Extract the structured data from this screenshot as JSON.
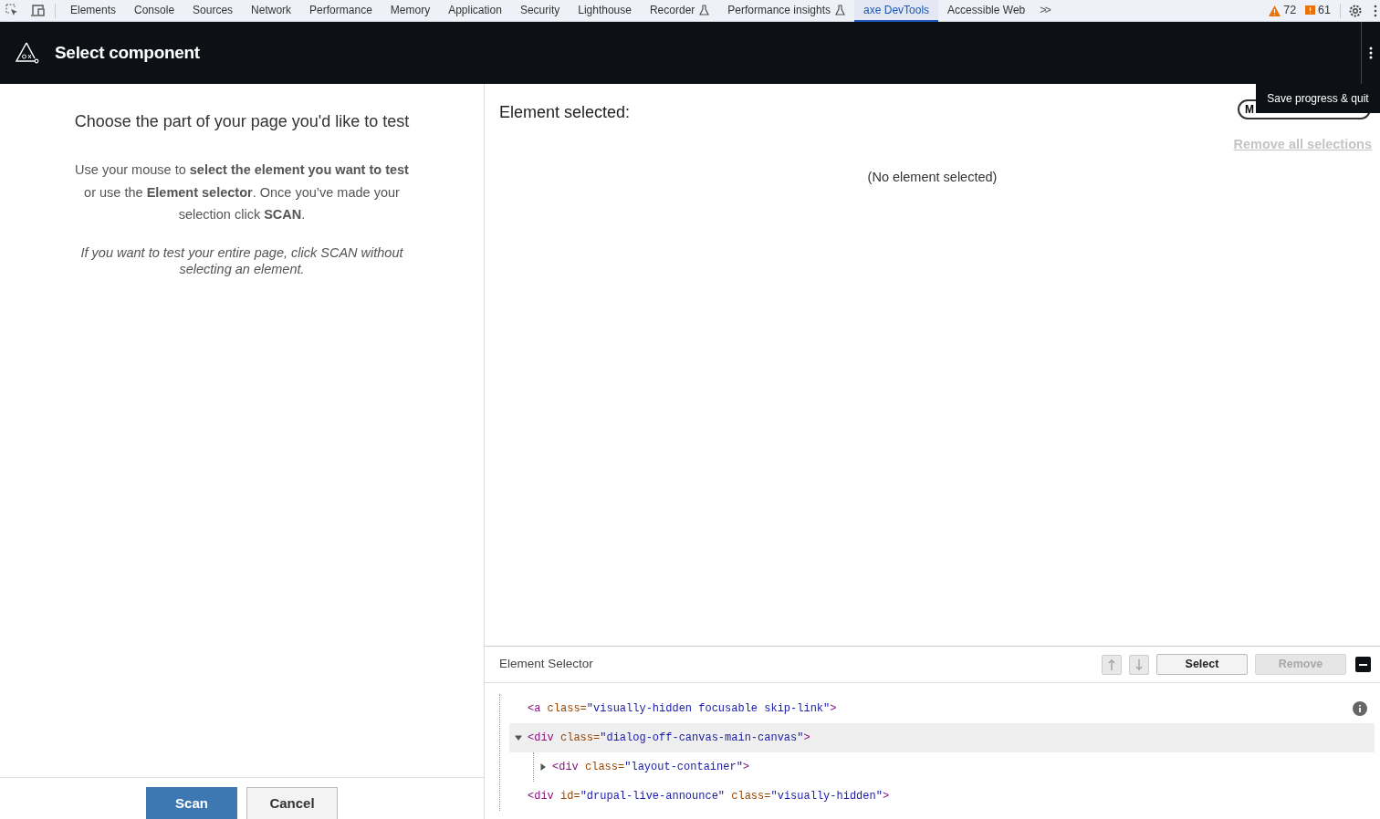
{
  "devtools_tabs": [
    {
      "label": "Elements",
      "selected": false,
      "experimental": false
    },
    {
      "label": "Console",
      "selected": false,
      "experimental": false
    },
    {
      "label": "Sources",
      "selected": false,
      "experimental": false
    },
    {
      "label": "Network",
      "selected": false,
      "experimental": false
    },
    {
      "label": "Performance",
      "selected": false,
      "experimental": false
    },
    {
      "label": "Memory",
      "selected": false,
      "experimental": false
    },
    {
      "label": "Application",
      "selected": false,
      "experimental": false
    },
    {
      "label": "Security",
      "selected": false,
      "experimental": false
    },
    {
      "label": "Lighthouse",
      "selected": false,
      "experimental": false
    },
    {
      "label": "Recorder",
      "selected": false,
      "experimental": true
    },
    {
      "label": "Performance insights",
      "selected": false,
      "experimental": true
    },
    {
      "label": "axe DevTools",
      "selected": true,
      "experimental": false
    },
    {
      "label": "Accessible Web",
      "selected": false,
      "experimental": false
    }
  ],
  "more_tabs": ">>",
  "counters": [
    {
      "kind": "warning",
      "count": "72"
    },
    {
      "kind": "issue",
      "count": "61"
    }
  ],
  "header": {
    "title": "Select component"
  },
  "left_panel": {
    "heading": "Choose the part of your page you'd like to test",
    "instructions": "Use your mouse to **select the element you want to test** or use the **Element selector**. Once you’ve made your selection click **SCAN**.",
    "note": "If you want to test your entire page, click SCAN without selecting an element.",
    "buttons": [
      {
        "label": "Scan",
        "kind": "primary"
      },
      {
        "label": "Cancel",
        "kind": "secondary"
      }
    ]
  },
  "right_panel": {
    "title": "Element selected:",
    "pill_text": "M",
    "tooltip": "Save progress & quit",
    "remove_all": "Remove all selections",
    "empty_message": "(No element selected)"
  },
  "element_selector": {
    "title": "Element Selector",
    "buttons": [
      {
        "label": "Select",
        "disabled": false
      },
      {
        "label": "Remove",
        "disabled": true
      }
    ],
    "tree": [
      {
        "selected": false,
        "segments": [
          {
            "kind": "tag",
            "text": "<a"
          },
          {
            "kind": "attr",
            "text": " class="
          },
          {
            "kind": "value",
            "text": "\"visually-hidden focusable skip-link\""
          },
          {
            "kind": "tag",
            "text": ">"
          }
        ]
      },
      {
        "selected": true,
        "expanded": true,
        "segments": [
          {
            "kind": "tag",
            "text": "<div"
          },
          {
            "kind": "attr",
            "text": " class="
          },
          {
            "kind": "value",
            "text": "\"dialog-off-canvas-main-canvas\""
          },
          {
            "kind": "tag",
            "text": ">"
          }
        ],
        "children": [
          {
            "selected": false,
            "expanded": false,
            "segments": [
              {
                "kind": "tag",
                "text": "<div"
              },
              {
                "kind": "attr",
                "text": " class="
              },
              {
                "kind": "value",
                "text": "\"layout-container\""
              },
              {
                "kind": "tag",
                "text": ">"
              }
            ]
          }
        ]
      },
      {
        "selected": false,
        "segments": [
          {
            "kind": "tag",
            "text": "<div"
          },
          {
            "kind": "attr",
            "text": " id="
          },
          {
            "kind": "value",
            "text": "\"drupal-live-announce\""
          },
          {
            "kind": "attr",
            "text": " class="
          },
          {
            "kind": "value",
            "text": "\"visually-hidden\""
          },
          {
            "kind": "tag",
            "text": ">"
          }
        ]
      }
    ]
  }
}
